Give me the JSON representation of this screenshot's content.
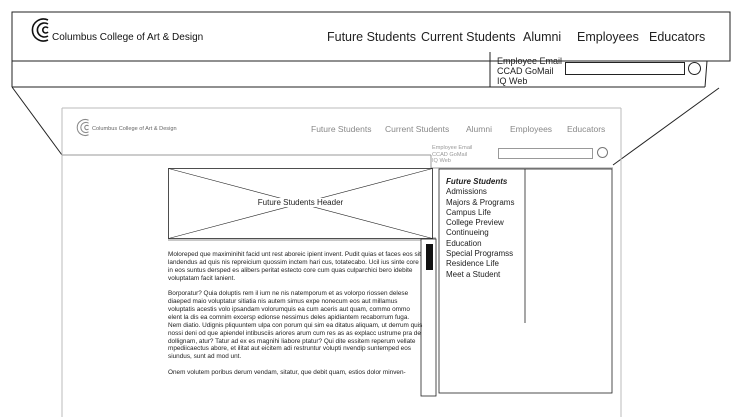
{
  "top_header": {
    "brand": "Columbus College of Art & Design",
    "nav": [
      "Future Students",
      "Current Students",
      "Alumni",
      "Employees",
      "Educators"
    ],
    "employee_links": [
      "Employee Email",
      "CCAD GoMail",
      "IQ Web"
    ]
  },
  "inner_page": {
    "brand": "Columbus College of Art & Design",
    "nav": [
      "Future Students",
      "Current Students",
      "Alumni",
      "Employees",
      "Educators"
    ],
    "employee_links": [
      "Employee Email",
      "CCAD GoMail",
      "IQ Web"
    ],
    "header_placeholder": "Future Students Header",
    "paragraphs": [
      "Moloreped que maximinihit facid unt rest aboreic ipient invent. Pudit quias et faces eos sit landendus ad quis nis repreicium quossim inctem hari cus, totatecabo. Ucil ius sinte core in eos suntus dersped es alibers peritat estecto core cum quas culparchici bero idebite voluptatam facit lanient.",
      "Borporatur? Quia doluptis rem il ium ne nis natemporum et as volorpo riossen delese diaeped maio voluptatur sitiatia nis autem simus expe nonecum eos aut millamus voluptatis acestis volo ipsandam volorumquis ea cum aceris aut quam, commo ommo elent la dis ea comnim excersp edionse nessimus deles apidiantem recaborrum fuga. Nem diatio. Udignis pliquuntem ulpa con porum qui sim ea ditatus aliquam, ut derrum quis nossi deni od que apiendel intibusciis ariores arum cum res as as explacc ustrume pra de dollignam, atur? Tatur ad ex es magnihi liabore ptatur? Qui dite essitem reperum vellate mpediicaectus abore, et ilitat aut eicitem adi restruntur volupti nvendip suntemped eos siundus, sunt ad mod unt.",
      "Onem volutem poribus derum vendam, sitatur, que debit quam, estios dolor minven-"
    ],
    "sidebar_title": "Future Students",
    "sidebar_items": [
      "Admissions",
      "Majors & Programs",
      "Campus Life",
      "College Preview",
      "Continueing Education",
      "Special Programss",
      "Residence Life",
      "Meet a Student"
    ]
  }
}
